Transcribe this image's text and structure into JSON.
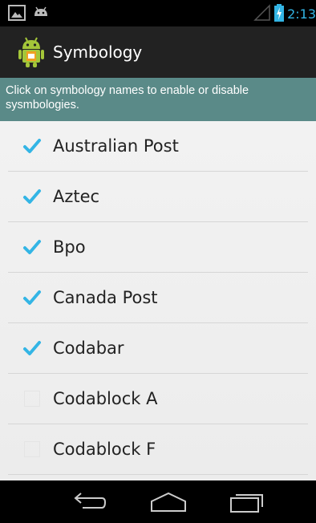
{
  "status_bar": {
    "time": "2:13",
    "left_icons": [
      "picture-icon",
      "android-notification-icon"
    ],
    "right_icons": [
      "signal-icon",
      "battery-charging-icon"
    ]
  },
  "action_bar": {
    "title": "Symbology",
    "icon": "android-app-icon"
  },
  "banner": {
    "text": "Click on symbology names to enable or disable sysmbologies."
  },
  "symbologies": [
    {
      "label": "Australian Post",
      "checked": true
    },
    {
      "label": "Aztec",
      "checked": true
    },
    {
      "label": "Bpo",
      "checked": true
    },
    {
      "label": "Canada Post",
      "checked": true
    },
    {
      "label": "Codabar",
      "checked": true
    },
    {
      "label": "Codablock A",
      "checked": false
    },
    {
      "label": "Codablock F",
      "checked": false
    }
  ],
  "nav_bar": {
    "buttons": [
      "back-icon",
      "home-icon",
      "recents-icon"
    ]
  },
  "colors": {
    "accent": "#33b5e5",
    "banner": "#5a8a88",
    "action_bar": "#222222",
    "check": "#33b5e5"
  }
}
